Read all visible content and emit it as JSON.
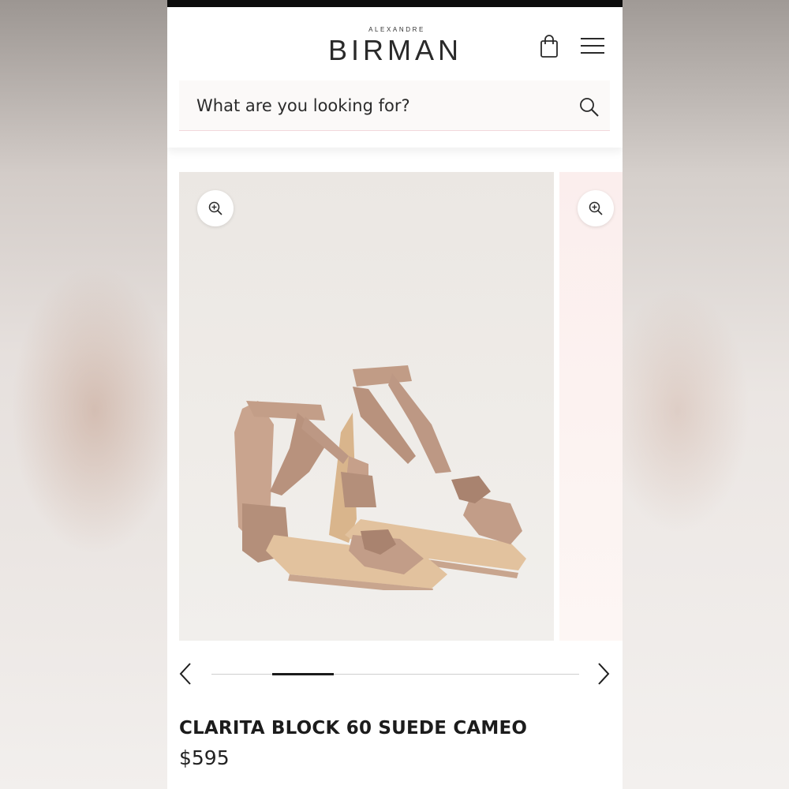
{
  "brand": {
    "small_text": "ALEXANDRE",
    "name": "BIRMAN"
  },
  "header": {
    "bag_icon": "shopping-bag-icon",
    "menu_icon": "hamburger-menu-icon"
  },
  "search": {
    "placeholder": "What are you looking for?",
    "value": "",
    "icon": "search-icon"
  },
  "gallery": {
    "image_alt": "Pair of suede block-heel sandals with ankle tie bows",
    "zoom_icon": "zoom-in-icon",
    "progress": 0.25
  },
  "product": {
    "name": "CLARITA BLOCK 60 SUEDE CAMEO",
    "price": "$595"
  },
  "colors": {
    "suede": "#c8a58e",
    "status_bar": "#0d0d0d",
    "accent_line": "#f2d8dc"
  }
}
